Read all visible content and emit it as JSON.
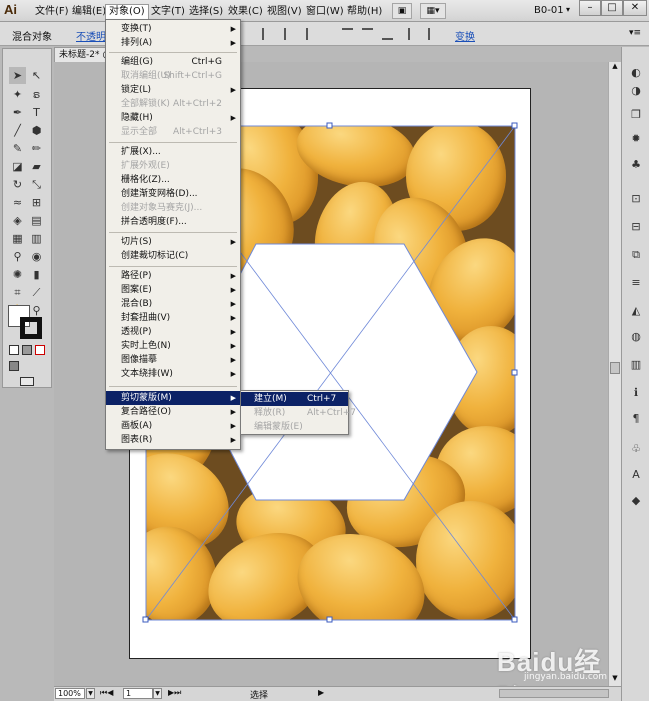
{
  "app": {
    "logo": "Ai",
    "workspace": "B0-01"
  },
  "menubar": {
    "items": [
      "文件(F)",
      "编辑(E)",
      "对象(O)",
      "文字(T)",
      "选择(S)",
      "效果(C)",
      "视图(V)",
      "窗口(W)",
      "帮助(H)"
    ],
    "active": "对象(O)"
  },
  "controlbar": {
    "selection_label": "混合对象",
    "opacity_label": "不透明度",
    "transform_label": "变换"
  },
  "document": {
    "tab_title": "未标题-2* @"
  },
  "object_menu": {
    "items": [
      {
        "label": "变换(T)",
        "shortcut": "",
        "submenu": true,
        "disabled": false
      },
      {
        "label": "排列(A)",
        "shortcut": "",
        "submenu": true,
        "disabled": false
      },
      {
        "label": "编组(G)",
        "shortcut": "Ctrl+G",
        "submenu": false,
        "disabled": false
      },
      {
        "label": "取消编组(U)",
        "shortcut": "Shift+Ctrl+G",
        "submenu": false,
        "disabled": true
      },
      {
        "label": "锁定(L)",
        "shortcut": "",
        "submenu": true,
        "disabled": false
      },
      {
        "label": "全部解锁(K)",
        "shortcut": "Alt+Ctrl+2",
        "submenu": false,
        "disabled": true
      },
      {
        "label": "隐藏(H)",
        "shortcut": "",
        "submenu": true,
        "disabled": false
      },
      {
        "label": "显示全部",
        "shortcut": "Alt+Ctrl+3",
        "submenu": false,
        "disabled": true
      },
      {
        "label": "扩展(X)...",
        "shortcut": "",
        "submenu": false,
        "disabled": false
      },
      {
        "label": "扩展外观(E)",
        "shortcut": "",
        "submenu": false,
        "disabled": true
      },
      {
        "label": "栅格化(Z)...",
        "shortcut": "",
        "submenu": false,
        "disabled": false
      },
      {
        "label": "创建渐变网格(D)...",
        "shortcut": "",
        "submenu": false,
        "disabled": false
      },
      {
        "label": "创建对象马赛克(J)...",
        "shortcut": "",
        "submenu": false,
        "disabled": true
      },
      {
        "label": "拼合透明度(F)...",
        "shortcut": "",
        "submenu": false,
        "disabled": false
      },
      {
        "label": "切片(S)",
        "shortcut": "",
        "submenu": true,
        "disabled": false
      },
      {
        "label": "创建裁切标记(C)",
        "shortcut": "",
        "submenu": false,
        "disabled": false
      },
      {
        "label": "路径(P)",
        "shortcut": "",
        "submenu": true,
        "disabled": false
      },
      {
        "label": "图案(E)",
        "shortcut": "",
        "submenu": true,
        "disabled": false
      },
      {
        "label": "混合(B)",
        "shortcut": "",
        "submenu": true,
        "disabled": false
      },
      {
        "label": "封套扭曲(V)",
        "shortcut": "",
        "submenu": true,
        "disabled": false
      },
      {
        "label": "透视(P)",
        "shortcut": "",
        "submenu": true,
        "disabled": false
      },
      {
        "label": "实时上色(N)",
        "shortcut": "",
        "submenu": true,
        "disabled": false
      },
      {
        "label": "图像描摹",
        "shortcut": "",
        "submenu": true,
        "disabled": false
      },
      {
        "label": "文本绕排(W)",
        "shortcut": "",
        "submenu": true,
        "disabled": false
      },
      {
        "label": "剪切蒙版(M)",
        "shortcut": "",
        "submenu": true,
        "disabled": false
      },
      {
        "label": "复合路径(O)",
        "shortcut": "",
        "submenu": true,
        "disabled": false
      },
      {
        "label": "画板(A)",
        "shortcut": "",
        "submenu": true,
        "disabled": false
      },
      {
        "label": "图表(R)",
        "shortcut": "",
        "submenu": true,
        "disabled": false
      }
    ],
    "highlighted": "剪切蒙版(M)"
  },
  "clipping_submenu": {
    "items": [
      {
        "label": "建立(M)",
        "shortcut": "Ctrl+7",
        "disabled": false
      },
      {
        "label": "释放(R)",
        "shortcut": "Alt+Ctrl+7",
        "disabled": true
      },
      {
        "label": "编辑蒙版(E)",
        "shortcut": "",
        "disabled": true
      }
    ],
    "highlighted": "建立(M)"
  },
  "statusbar": {
    "zoom": "100%",
    "page": "1",
    "status": "选择"
  },
  "watermark": {
    "main": "Baidu经验",
    "sub": "jingyan.baidu.com"
  },
  "colors": {
    "menu_highlight": "#0c2266",
    "link": "#1a4fb8"
  }
}
